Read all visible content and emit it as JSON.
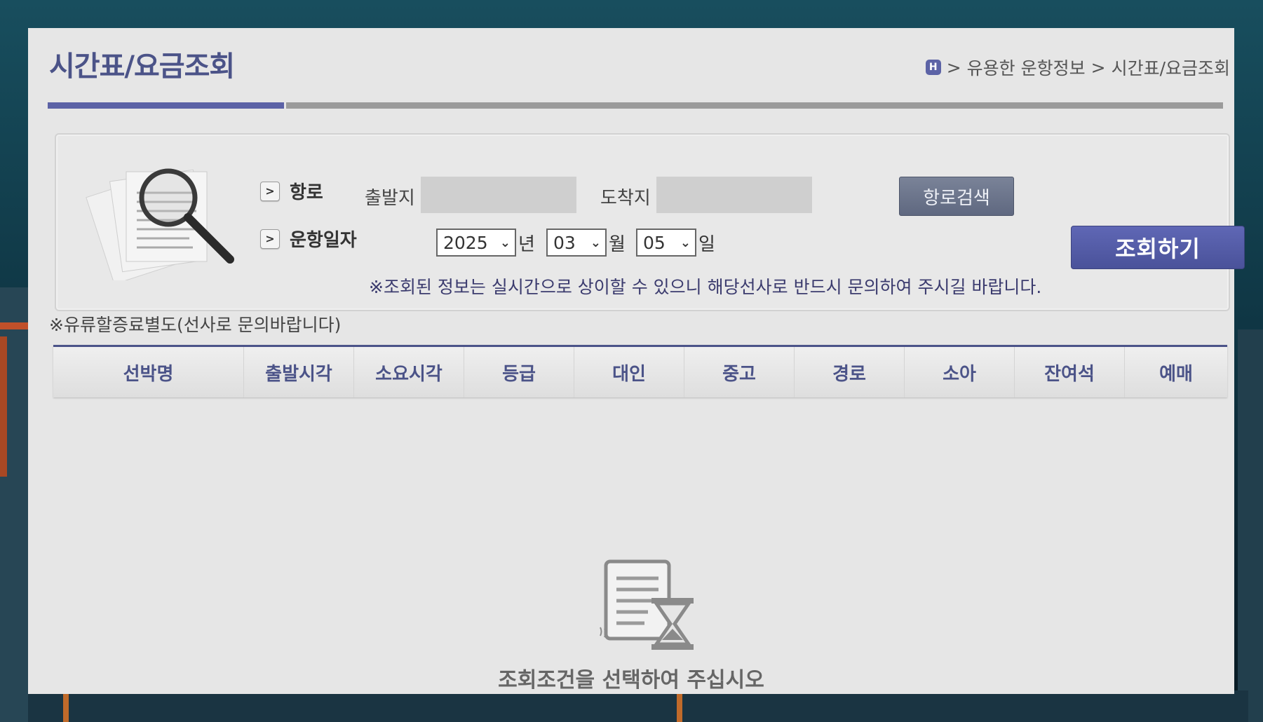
{
  "page": {
    "title": "시간표/요금조회"
  },
  "breadcrumb": {
    "home_icon": "home-icon",
    "home_glyph": "H",
    "items": [
      "유용한 운항정보",
      "시간표/요금조회"
    ],
    "separator": ">"
  },
  "search": {
    "route_label": "항로",
    "departure_label": "출발지",
    "departure_value": "",
    "arrival_label": "도착지",
    "arrival_value": "",
    "route_search_button": "항로검색",
    "date_label": "운항일자",
    "year_value": "2025",
    "year_unit": "년",
    "month_value": "03",
    "month_unit": "월",
    "day_value": "05",
    "day_unit": "일",
    "search_button": "조회하기",
    "notice": "※조회된 정보는 실시간으로 상이할 수 있으니 해당선사로 반드시 문의하여 주시길 바랍니다.",
    "chevron_glyph": ">"
  },
  "fuel_note": "※유류할증료별도(선사로 문의바랍니다)",
  "table": {
    "columns": [
      "선박명",
      "출발시각",
      "소요시각",
      "등급",
      "대인",
      "중고",
      "경로",
      "소아",
      "잔여석",
      "예매"
    ]
  },
  "empty_state": {
    "icon": "document-hourglass-icon",
    "message": "조회조건을 선택하여 주십시오"
  },
  "colors": {
    "accent": "#4b5388",
    "button_primary": "#525aa4",
    "button_secondary": "#6b7389",
    "panel_bg": "#e6e6e6"
  }
}
